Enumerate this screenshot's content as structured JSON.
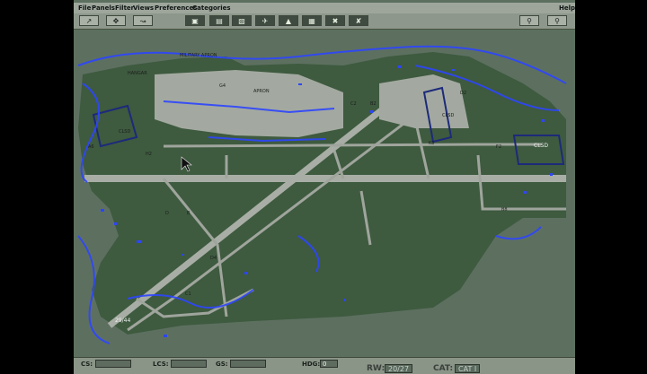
{
  "menu": {
    "file": "File",
    "panels": "Panels",
    "filter": "Filter",
    "views": "Views",
    "preferences": "Preferences",
    "categories": "Categories",
    "help": "Help"
  },
  "toolbar": {
    "left_icons": [
      "pointer-icon",
      "pan-icon",
      "route-icon"
    ],
    "center_icons": [
      "display-icon",
      "layers-icon",
      "runway-icon",
      "aircraft-icon",
      "tower-icon",
      "map-icon",
      "close-taxi-icon",
      "clear-icon"
    ],
    "right_icons": [
      "zoom-in-icon",
      "zoom-out-icon"
    ]
  },
  "map": {
    "labels": {
      "military_apron": "MILITARY APRON",
      "hangar": "HANGAR",
      "apron": "APRON",
      "clsd_1": "CLSD",
      "clsd_2": "CLSD",
      "clsd_3": "CLSD",
      "runway_end": "29/44",
      "b": "B",
      "b8": "B8",
      "d": "D",
      "g4": "G4",
      "d4": "D4",
      "c1": "C1",
      "a6": "A6",
      "h2": "H2",
      "c2": "C2",
      "b2": "B2",
      "k8": "K8",
      "f2": "F2",
      "d2": "D2"
    },
    "colors": {
      "background": "#5d7060",
      "grass": "#3d5a3c",
      "pavement": "#9fa59c",
      "weather": "#2d45ff",
      "closed_outline": "#1d2a7a"
    }
  },
  "status": {
    "cs_label": "CS:",
    "cs_value": "",
    "lcs_label": "LCS:",
    "lcs_value": "",
    "gs_label": "GS:",
    "gs_value": "",
    "hdg_label": "HDG:",
    "hdg_value": "0",
    "rwy_label": "RW:",
    "rwy_value": "20/27",
    "cat_label": "CAT:",
    "cat_value": "CAT I"
  }
}
